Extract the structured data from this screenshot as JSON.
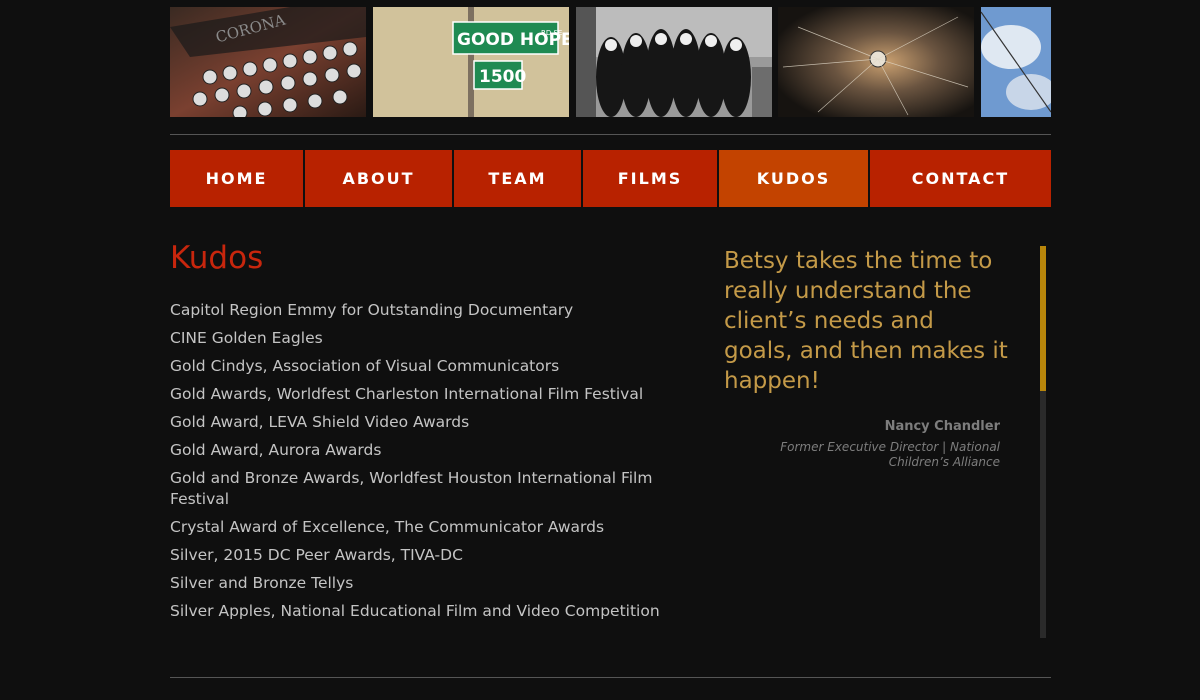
{
  "nav": {
    "items": [
      {
        "label": "HOME"
      },
      {
        "label": "ABOUT"
      },
      {
        "label": "TEAM"
      },
      {
        "label": "FILMS"
      },
      {
        "label": "KUDOS"
      },
      {
        "label": "CONTACT"
      }
    ],
    "active": "KUDOS"
  },
  "photos": {
    "typewriter_brand": "CORONA",
    "street_sign_text": "GOOD HOPE",
    "street_sign_suffix": "RD SE",
    "street_sign_number": "1500"
  },
  "main": {
    "heading": "Kudos",
    "kudos": [
      "Capitol Region Emmy for Outstanding Documentary",
      "CINE Golden Eagles",
      "Gold Cindys, Association of Visual Communicators",
      "Gold Awards, Worldfest Charleston International Film Festival",
      "Gold Award, LEVA Shield Video Awards",
      "Gold Award, Aurora Awards",
      "Gold and Bronze Awards, Worldfest Houston International Film Festival",
      "Crystal Award of Excellence, The Communicator Awards",
      "Silver, 2015 DC Peer Awards, TIVA-DC",
      "Silver and Bronze Tellys",
      "Silver Apples, National Educational Film and Video Competition"
    ]
  },
  "testimonial": {
    "quote": "Betsy takes the time to really understand the client’s needs and goals, and then makes it happen!",
    "name": "Nancy Chandler",
    "role": "Former Executive Director | National Children’s Alliance"
  },
  "colors": {
    "nav_bg": "#b82200",
    "nav_active_bg": "#c34300",
    "heading": "#c8260d",
    "quote": "#c49a48",
    "scroll_thumb": "#b8860b",
    "page_bg": "#0f0f0f"
  }
}
